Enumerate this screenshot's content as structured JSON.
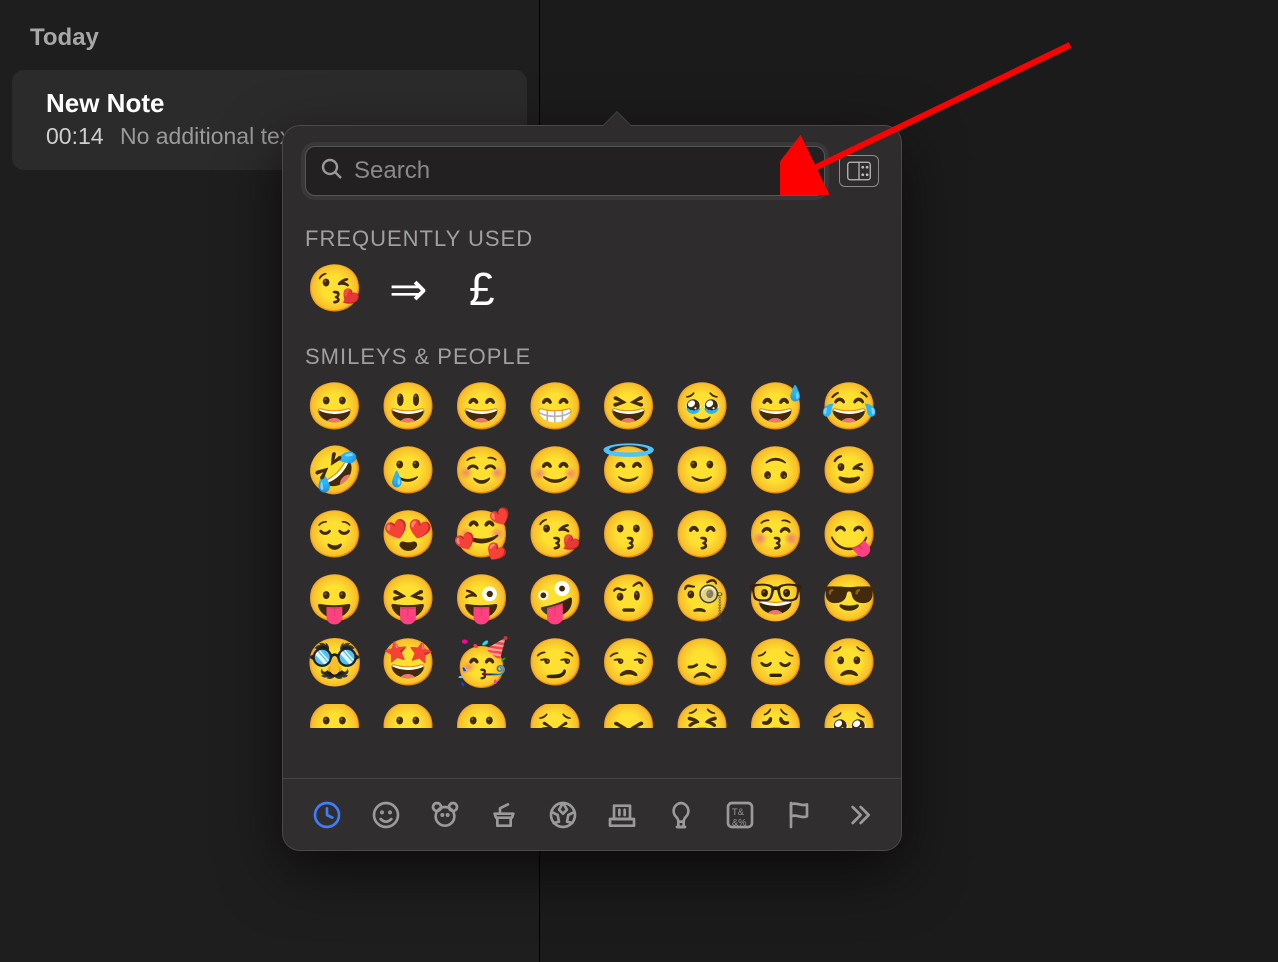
{
  "sidebar": {
    "section_label": "Today",
    "note": {
      "title": "New Note",
      "time": "00:14",
      "preview": "No additional text"
    }
  },
  "picker": {
    "search_placeholder": "Search",
    "groups": {
      "frequent_label": "FREQUENTLY USED",
      "smileys_label": "SMILEYS & PEOPLE"
    },
    "frequent": [
      "😘",
      "⇒",
      "£"
    ],
    "smileys": [
      "😀",
      "😃",
      "😄",
      "😁",
      "😆",
      "🥹",
      "😅",
      "😂",
      "🤣",
      "🥲",
      "☺️",
      "😊",
      "😇",
      "🙂",
      "🙃",
      "😉",
      "😌",
      "😍",
      "🥰",
      "😘",
      "😗",
      "😙",
      "😚",
      "😋",
      "😛",
      "😝",
      "😜",
      "🤪",
      "🤨",
      "🧐",
      "🤓",
      "😎",
      "🥸",
      "🤩",
      "🥳",
      "😏",
      "😒",
      "😞",
      "😔",
      "😟",
      "😕",
      "🙁",
      "☹️",
      "😣",
      "😖",
      "😫",
      "😩",
      "🥺"
    ],
    "categories": [
      {
        "name": "recent",
        "active": true
      },
      {
        "name": "smileys",
        "active": false
      },
      {
        "name": "animals",
        "active": false
      },
      {
        "name": "food",
        "active": false
      },
      {
        "name": "activity",
        "active": false
      },
      {
        "name": "travel",
        "active": false
      },
      {
        "name": "objects",
        "active": false
      },
      {
        "name": "symbols",
        "active": false
      },
      {
        "name": "flags",
        "active": false
      },
      {
        "name": "more",
        "active": false
      }
    ]
  }
}
